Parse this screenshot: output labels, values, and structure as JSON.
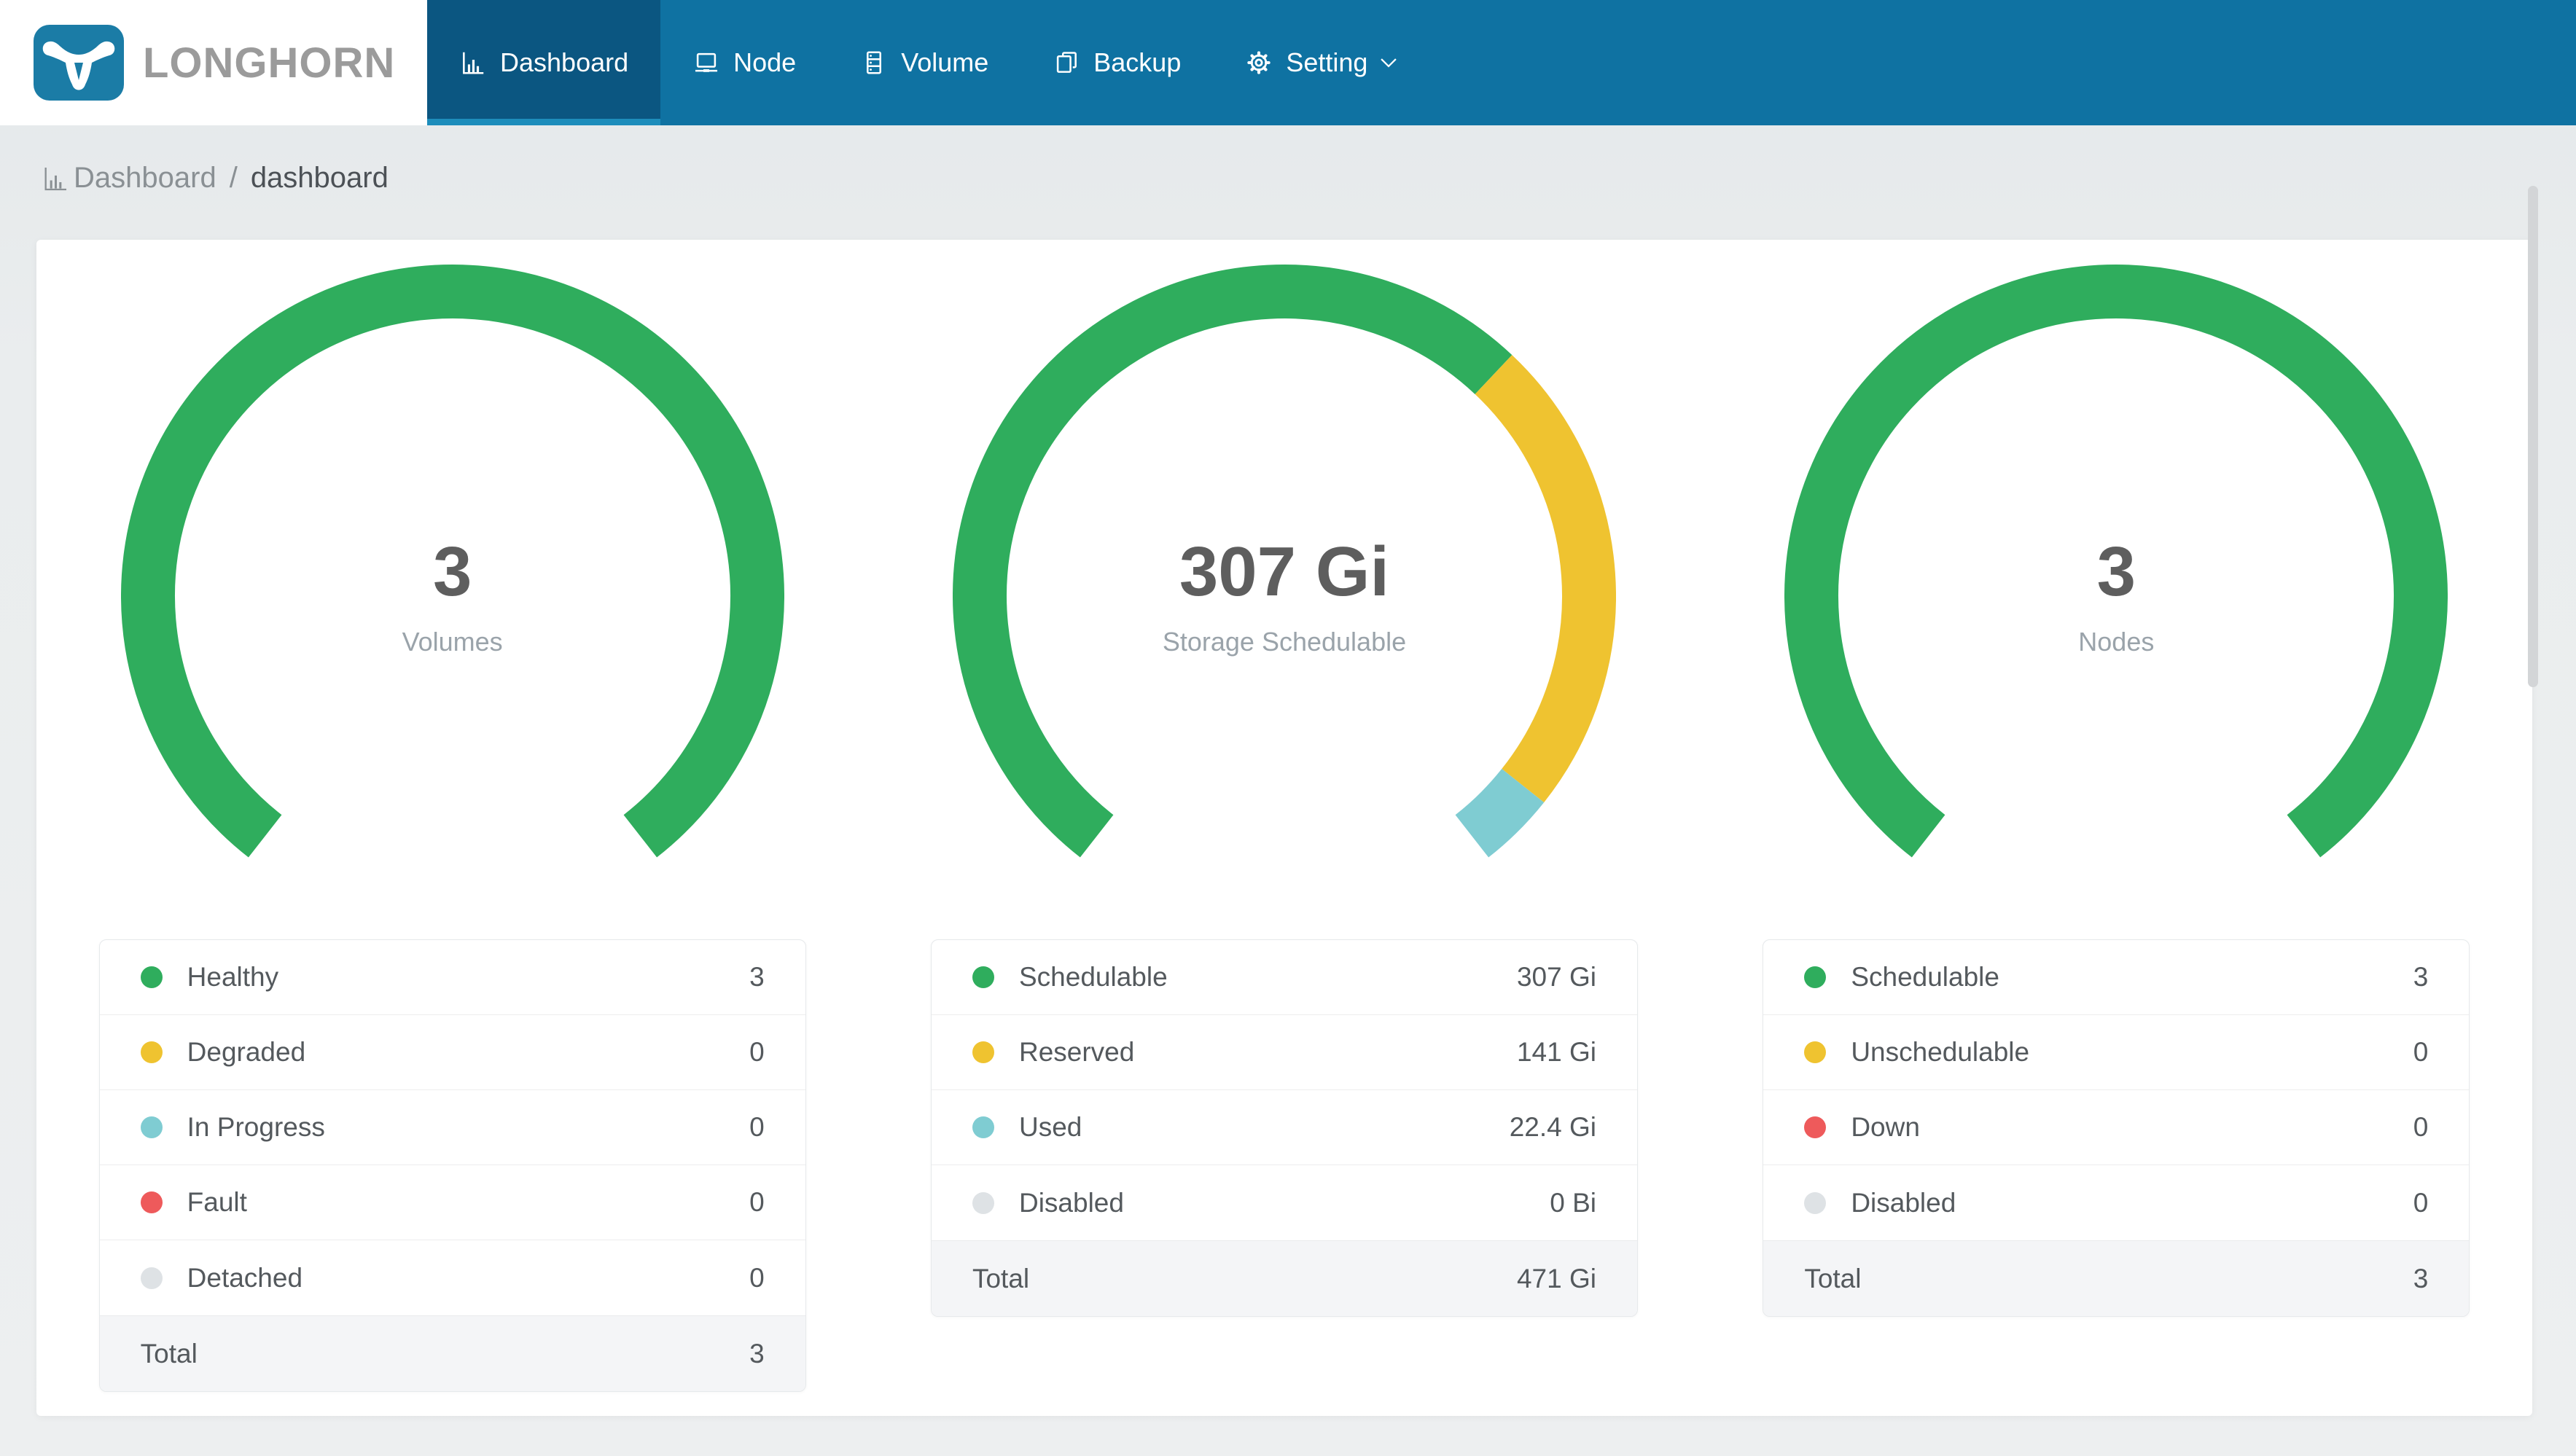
{
  "app": {
    "logo_text": "LONGHORN"
  },
  "nav": {
    "items": [
      {
        "label": "Dashboard",
        "icon": "bar-chart-icon",
        "active": true
      },
      {
        "label": "Node",
        "icon": "laptop-icon",
        "active": false
      },
      {
        "label": "Volume",
        "icon": "server-icon",
        "active": false
      },
      {
        "label": "Backup",
        "icon": "copy-icon",
        "active": false
      },
      {
        "label": "Setting",
        "icon": "gear-icon",
        "active": false,
        "caret": true
      }
    ]
  },
  "breadcrumb": {
    "section": "Dashboard",
    "separator": "/",
    "page": "dashboard"
  },
  "colors": {
    "navbar": "#0f72a2",
    "navbar_active": "#0b5681",
    "navbar_active_underline": "#1d8dbb",
    "logo_tile": "#1b7ca6",
    "green": "#2fad5d",
    "yellow": "#efc330",
    "teal": "#7fccd2",
    "red": "#ee5a5b",
    "gray": "#dee2e5"
  },
  "chart_data": [
    {
      "type": "gauge",
      "center_value": "3",
      "center_label": "Volumes",
      "start_deg": 218,
      "sweep_deg": 284,
      "segments": [
        {
          "label": "Healthy",
          "value": 3,
          "display": "3",
          "color": "#2fad5d"
        },
        {
          "label": "Degraded",
          "value": 0,
          "display": "0",
          "color": "#efc330"
        },
        {
          "label": "In Progress",
          "value": 0,
          "display": "0",
          "color": "#7fccd2"
        },
        {
          "label": "Fault",
          "value": 0,
          "display": "0",
          "color": "#ee5a5b"
        },
        {
          "label": "Detached",
          "value": 0,
          "display": "0",
          "color": "#dee2e5"
        }
      ],
      "total": {
        "label": "Total",
        "display": "3"
      }
    },
    {
      "type": "gauge",
      "center_value": "307 Gi",
      "center_label": "Storage Schedulable",
      "start_deg": 218,
      "sweep_deg": 284,
      "segments": [
        {
          "label": "Schedulable",
          "value": 307,
          "display": "307 Gi",
          "color": "#2fad5d"
        },
        {
          "label": "Reserved",
          "value": 141,
          "display": "141 Gi",
          "color": "#efc330"
        },
        {
          "label": "Used",
          "value": 22.4,
          "display": "22.4 Gi",
          "color": "#7fccd2"
        },
        {
          "label": "Disabled",
          "value": 0,
          "display": "0 Bi",
          "color": "#dee2e5"
        }
      ],
      "total": {
        "label": "Total",
        "display": "471 Gi"
      }
    },
    {
      "type": "gauge",
      "center_value": "3",
      "center_label": "Nodes",
      "start_deg": 218,
      "sweep_deg": 284,
      "segments": [
        {
          "label": "Schedulable",
          "value": 3,
          "display": "3",
          "color": "#2fad5d"
        },
        {
          "label": "Unschedulable",
          "value": 0,
          "display": "0",
          "color": "#efc330"
        },
        {
          "label": "Down",
          "value": 0,
          "display": "0",
          "color": "#ee5a5b"
        },
        {
          "label": "Disabled",
          "value": 0,
          "display": "0",
          "color": "#dee2e5"
        }
      ],
      "total": {
        "label": "Total",
        "display": "3"
      }
    }
  ]
}
